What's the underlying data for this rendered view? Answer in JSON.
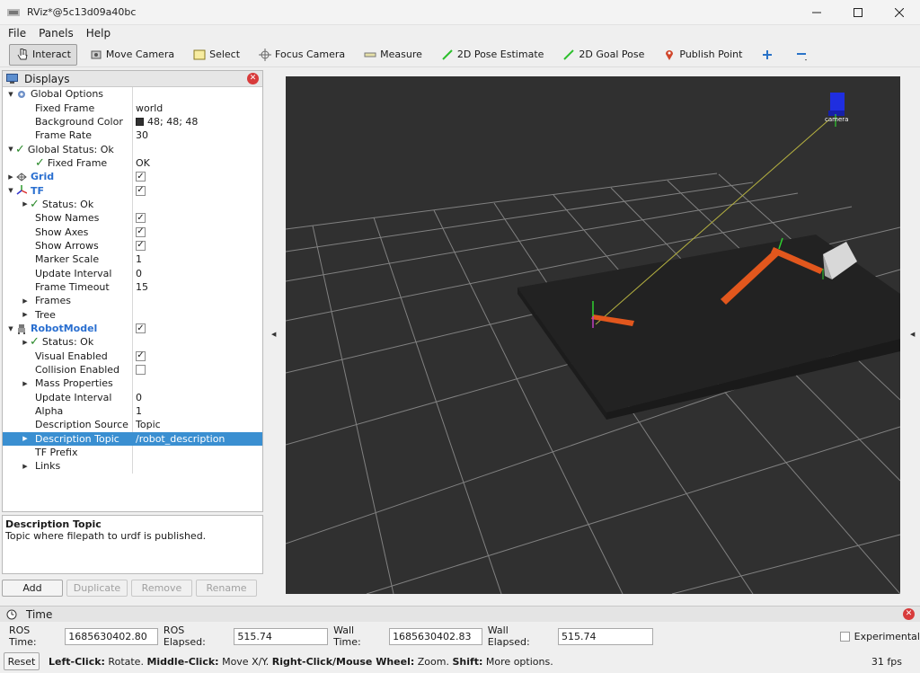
{
  "window": {
    "title": "RViz*@5c13d09a40bc"
  },
  "menu": [
    "File",
    "Panels",
    "Help"
  ],
  "toolbar": {
    "interact": "Interact",
    "move_camera": "Move Camera",
    "select": "Select",
    "focus_camera": "Focus Camera",
    "measure": "Measure",
    "pose_estimate": "2D Pose Estimate",
    "goal_pose": "2D Goal Pose",
    "publish_point": "Publish Point"
  },
  "displays": {
    "title": "Displays",
    "rows": [
      {
        "label": "Global Options",
        "value": ""
      },
      {
        "label": "Fixed Frame",
        "value": "world"
      },
      {
        "label": "Background Color",
        "value": "48; 48; 48"
      },
      {
        "label": "Frame Rate",
        "value": "30"
      },
      {
        "label": "Global Status: Ok",
        "value": ""
      },
      {
        "label": "Fixed Frame",
        "value": "OK"
      },
      {
        "label": "Grid",
        "value": ""
      },
      {
        "label": "TF",
        "value": ""
      },
      {
        "label": "Status: Ok",
        "value": ""
      },
      {
        "label": "Show Names",
        "value": ""
      },
      {
        "label": "Show Axes",
        "value": ""
      },
      {
        "label": "Show Arrows",
        "value": ""
      },
      {
        "label": "Marker Scale",
        "value": "1"
      },
      {
        "label": "Update Interval",
        "value": "0"
      },
      {
        "label": "Frame Timeout",
        "value": "15"
      },
      {
        "label": "Frames",
        "value": ""
      },
      {
        "label": "Tree",
        "value": ""
      },
      {
        "label": "RobotModel",
        "value": ""
      },
      {
        "label": "Status: Ok",
        "value": ""
      },
      {
        "label": "Visual Enabled",
        "value": ""
      },
      {
        "label": "Collision Enabled",
        "value": ""
      },
      {
        "label": "Mass Properties",
        "value": ""
      },
      {
        "label": "Update Interval",
        "value": "0"
      },
      {
        "label": "Alpha",
        "value": "1"
      },
      {
        "label": "Description Source",
        "value": "Topic"
      },
      {
        "label": "Description Topic",
        "value": "/robot_description"
      },
      {
        "label": "TF Prefix",
        "value": ""
      },
      {
        "label": "Links",
        "value": ""
      }
    ]
  },
  "description": {
    "title": "Description Topic",
    "text": "Topic where filepath to urdf is published."
  },
  "buttons": {
    "add": "Add",
    "duplicate": "Duplicate",
    "remove": "Remove",
    "rename": "Rename"
  },
  "viewport": {
    "camera_label": "camera",
    "background": "#303030"
  },
  "time": {
    "title": "Time",
    "ros_time_label": "ROS Time:",
    "ros_time": "1685630402.80",
    "ros_elapsed_label": "ROS Elapsed:",
    "ros_elapsed": "515.74",
    "wall_time_label": "Wall Time:",
    "wall_time": "1685630402.83",
    "wall_elapsed_label": "Wall Elapsed:",
    "wall_elapsed": "515.74",
    "experimental_label": "Experimental"
  },
  "status": {
    "reset": "Reset",
    "hint_1": "Left-Click:",
    "hint_1b": " Rotate. ",
    "hint_2": "Middle-Click:",
    "hint_2b": " Move X/Y. ",
    "hint_3": "Right-Click/Mouse Wheel:",
    "hint_3b": " Zoom. ",
    "hint_4": "Shift:",
    "hint_4b": " More options.",
    "fps": "31 fps"
  }
}
